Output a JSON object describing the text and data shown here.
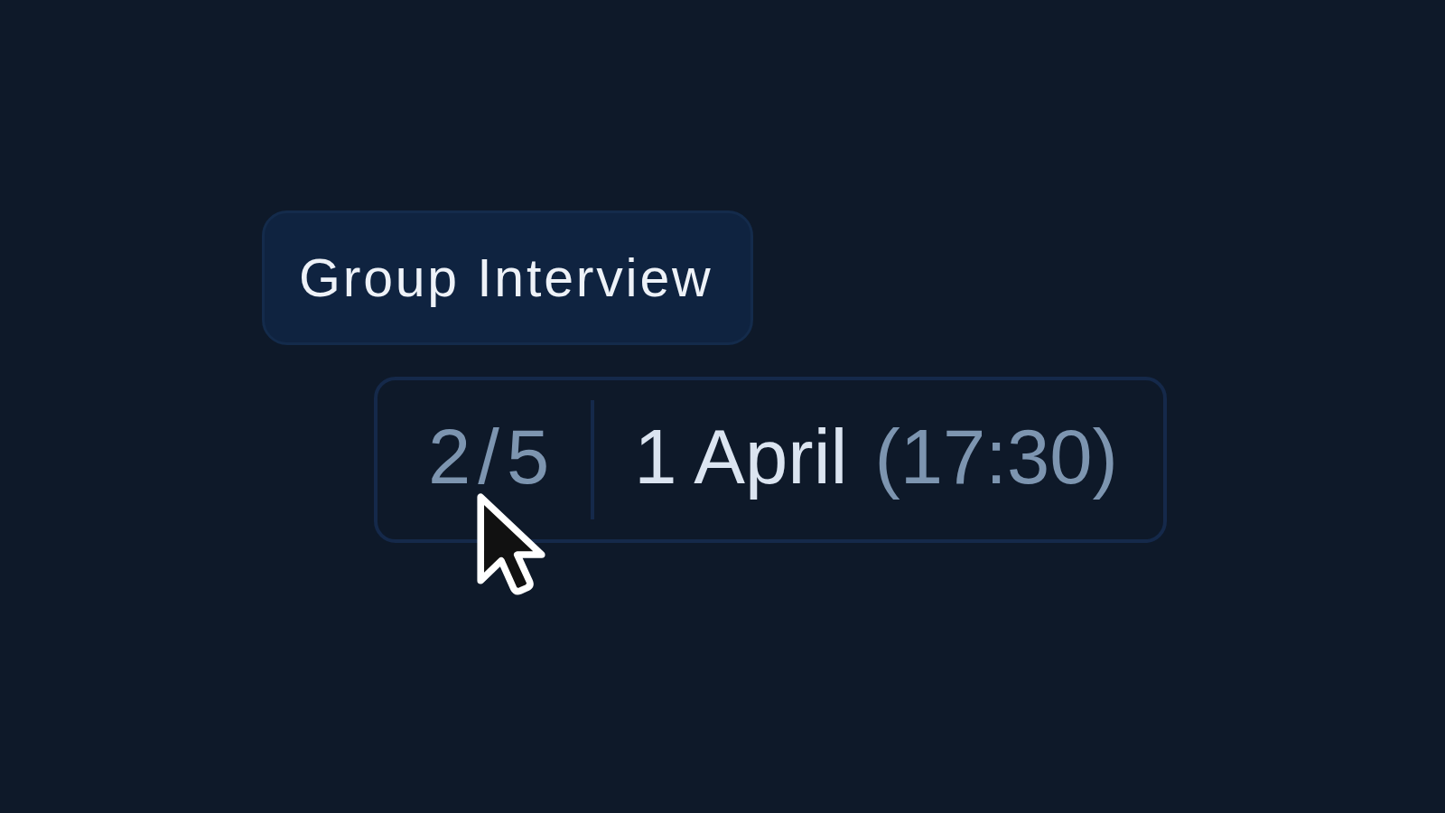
{
  "tag": {
    "label": "Group Interview"
  },
  "slot": {
    "count": "2/5",
    "date": "1 April",
    "time": "(17:30)"
  }
}
